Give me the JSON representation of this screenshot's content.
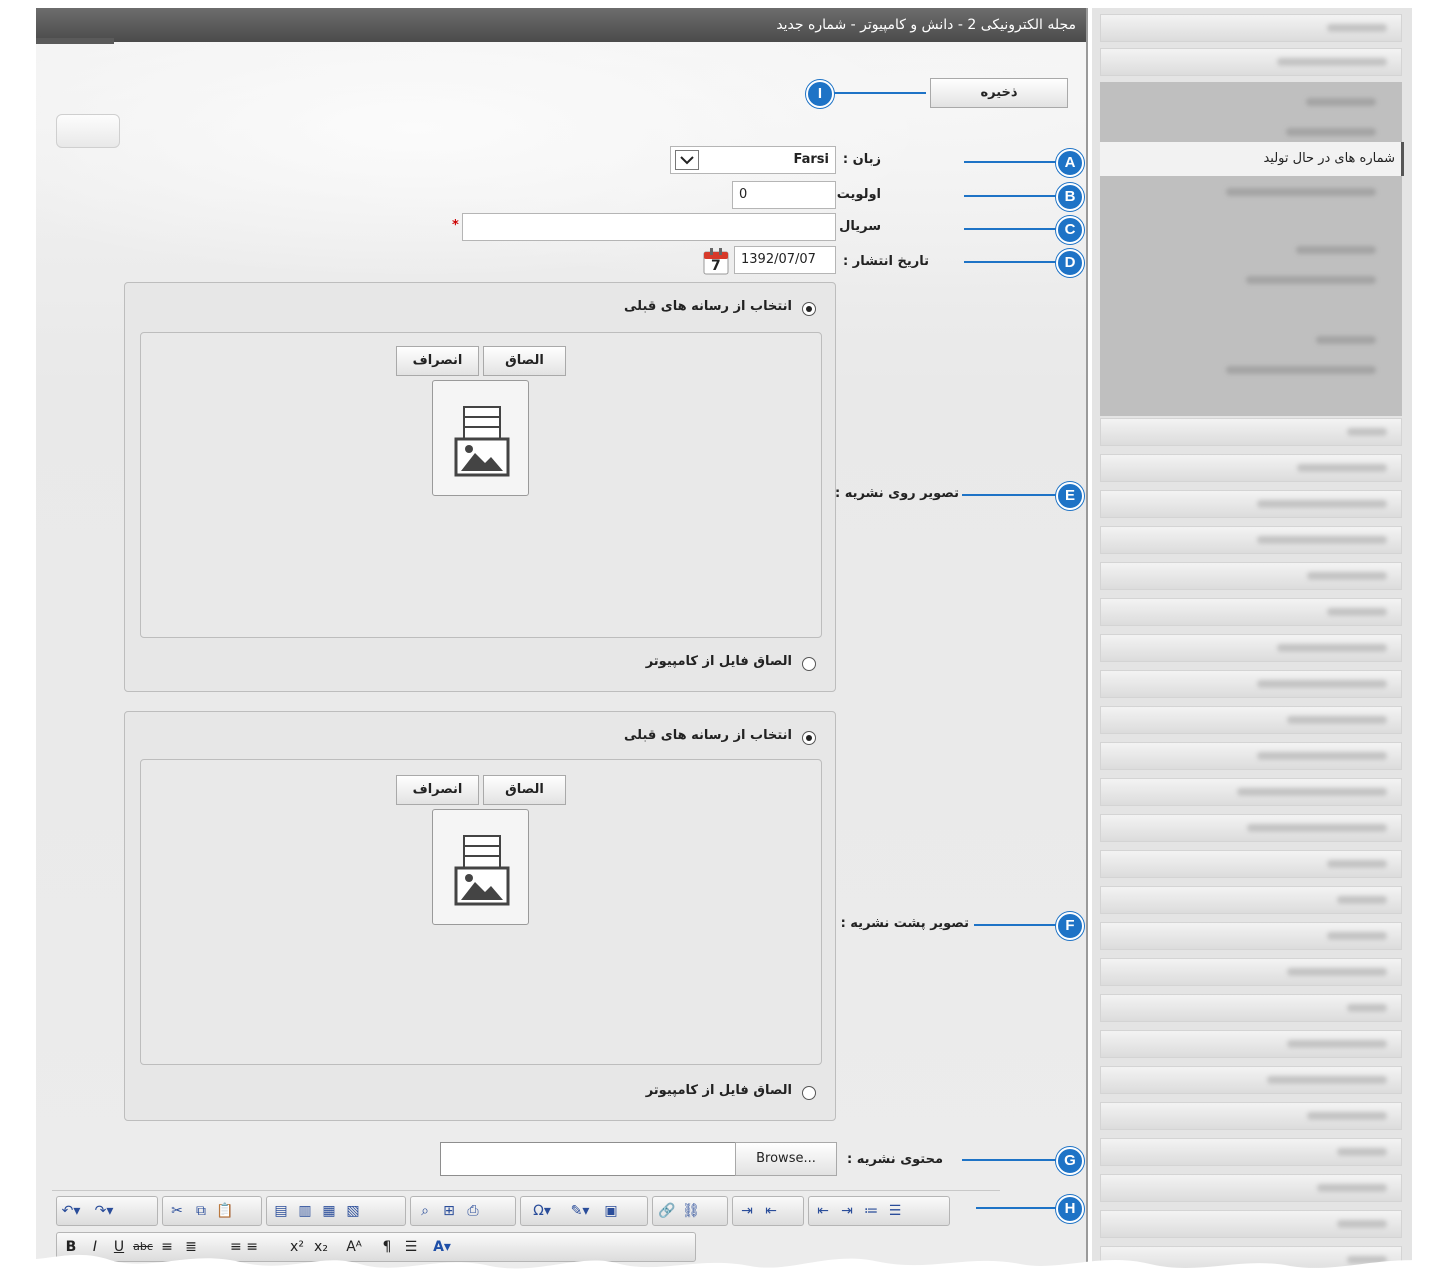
{
  "window": {
    "title": "مجله الکترونیکی 2 - دانش و کامپیوتر - شماره جدید"
  },
  "sidebar": {
    "active_item": "شماره های در حال تولید"
  },
  "form": {
    "save_label": "ذخیره",
    "language": {
      "label": "زبان :",
      "value": "Farsi"
    },
    "priority": {
      "label": "اولویت :",
      "value": "0"
    },
    "serial": {
      "label": "سریال :",
      "value": "",
      "required_mark": "*"
    },
    "publish_date": {
      "label": "تاریخ انتشار :",
      "value": "1392/07/07",
      "calendar_day": "7"
    },
    "cover_front": {
      "label": "تصویر روی نشریه :",
      "option_previous": "انتخاب از رسانه های قبلی",
      "attach_label": "الصاق",
      "cancel_label": "انصراف",
      "option_upload": "الصاق فایل از کامپیوتر"
    },
    "cover_back": {
      "label": "تصویر پشت نشریه :",
      "option_previous": "انتخاب از رسانه های قبلی",
      "attach_label": "الصاق",
      "cancel_label": "انصراف",
      "option_upload": "الصاق فایل از کامپیوتر"
    },
    "content": {
      "label": "محتوی نشریه :",
      "browse_label": "Browse..."
    }
  },
  "callouts": {
    "I": "I",
    "A": "A",
    "B": "B",
    "C": "C",
    "D": "D",
    "E": "E",
    "F": "F",
    "G": "G",
    "H": "H"
  },
  "colors": {
    "accent": "#1e73c6",
    "titlebar": "#555555",
    "required": "#cc0000"
  },
  "toolbar": {
    "row1": [
      "undo-icon",
      "redo-icon",
      "cut-icon",
      "copy-icon",
      "paste-icon",
      "paste-text-icon",
      "paste-word-icon",
      "paste-special-icon",
      "paste-clean-icon",
      "find-icon",
      "select-all-icon",
      "print-icon",
      "special-char-icon",
      "format-painter-icon",
      "template-icon",
      "link-icon",
      "unlink-icon",
      "ltr-icon",
      "rtl-icon",
      "outdent-icon",
      "indent-icon",
      "numbered-list-icon",
      "bullet-list-icon"
    ],
    "row2": [
      "bold-icon",
      "italic-icon",
      "underline-icon",
      "strikethrough-icon",
      "align-left-icon",
      "align-center-icon",
      "superscript-icon",
      "subscript-icon",
      "font-size-icon",
      "font-color-icon"
    ]
  }
}
